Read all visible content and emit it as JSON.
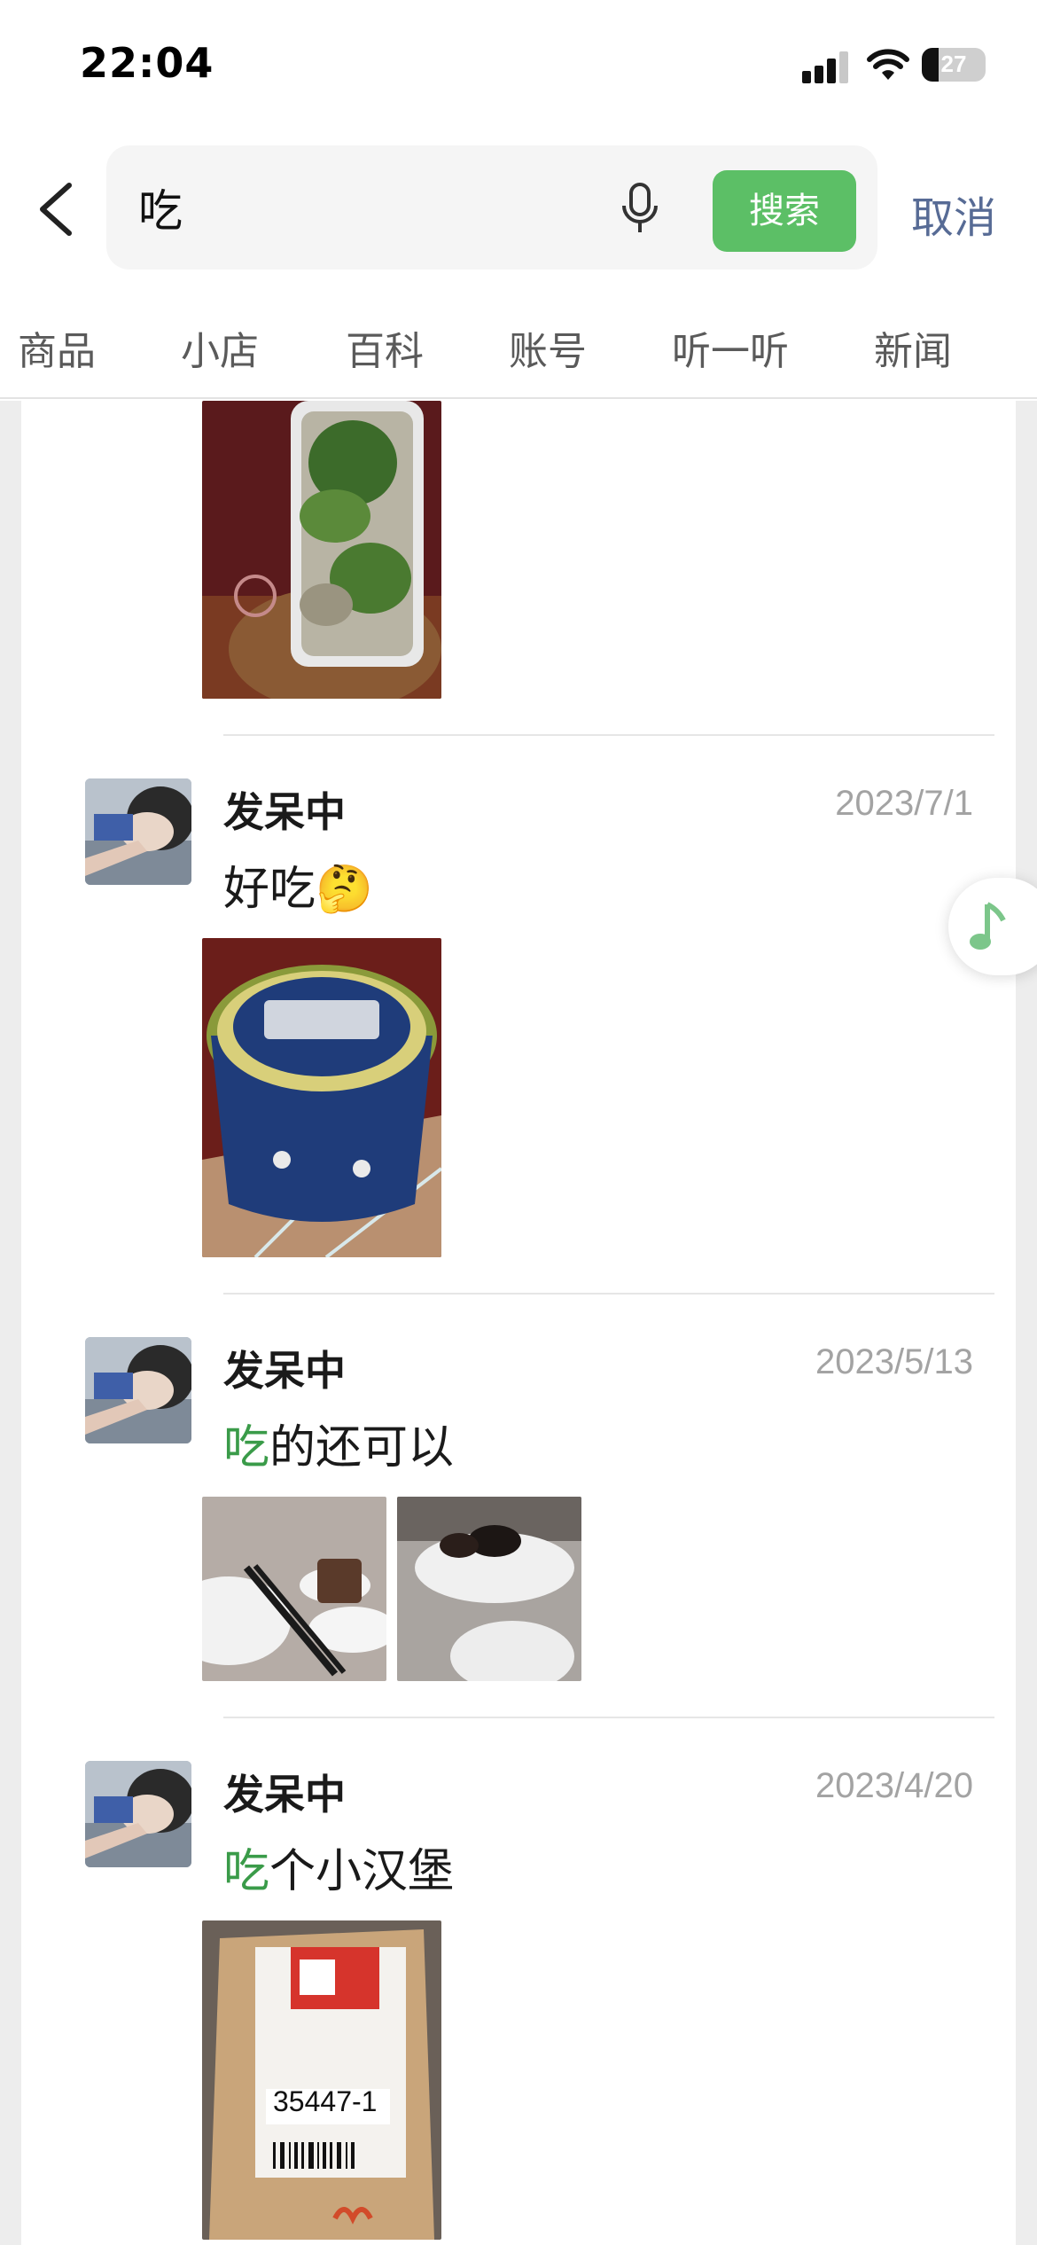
{
  "status_bar": {
    "time": "22:04",
    "battery": "27"
  },
  "search": {
    "query": "吃",
    "button_label": "搜索",
    "cancel_label": "取消"
  },
  "tabs": [
    "商品",
    "小店",
    "百科",
    "账号",
    "听一听",
    "新闻"
  ],
  "posts": [
    {
      "author": "发呆中",
      "date": "2023/7/1",
      "text": "好吃🤔"
    },
    {
      "author": "发呆中",
      "date": "2023/5/13",
      "text_highlight": "吃",
      "text_rest": "的还可以"
    },
    {
      "author": "发呆中",
      "date": "2023/4/20",
      "text_highlight": "吃",
      "text_rest": "个小汉堡"
    }
  ],
  "receipt_number": "35447-1",
  "colors": {
    "accent_green": "#5cbf66",
    "cancel_blue": "#576b95",
    "highlight": "#3a9b49"
  },
  "icons": [
    "back-chevron-icon",
    "mic-icon",
    "signal-icon",
    "wifi-icon",
    "music-note-icon"
  ]
}
